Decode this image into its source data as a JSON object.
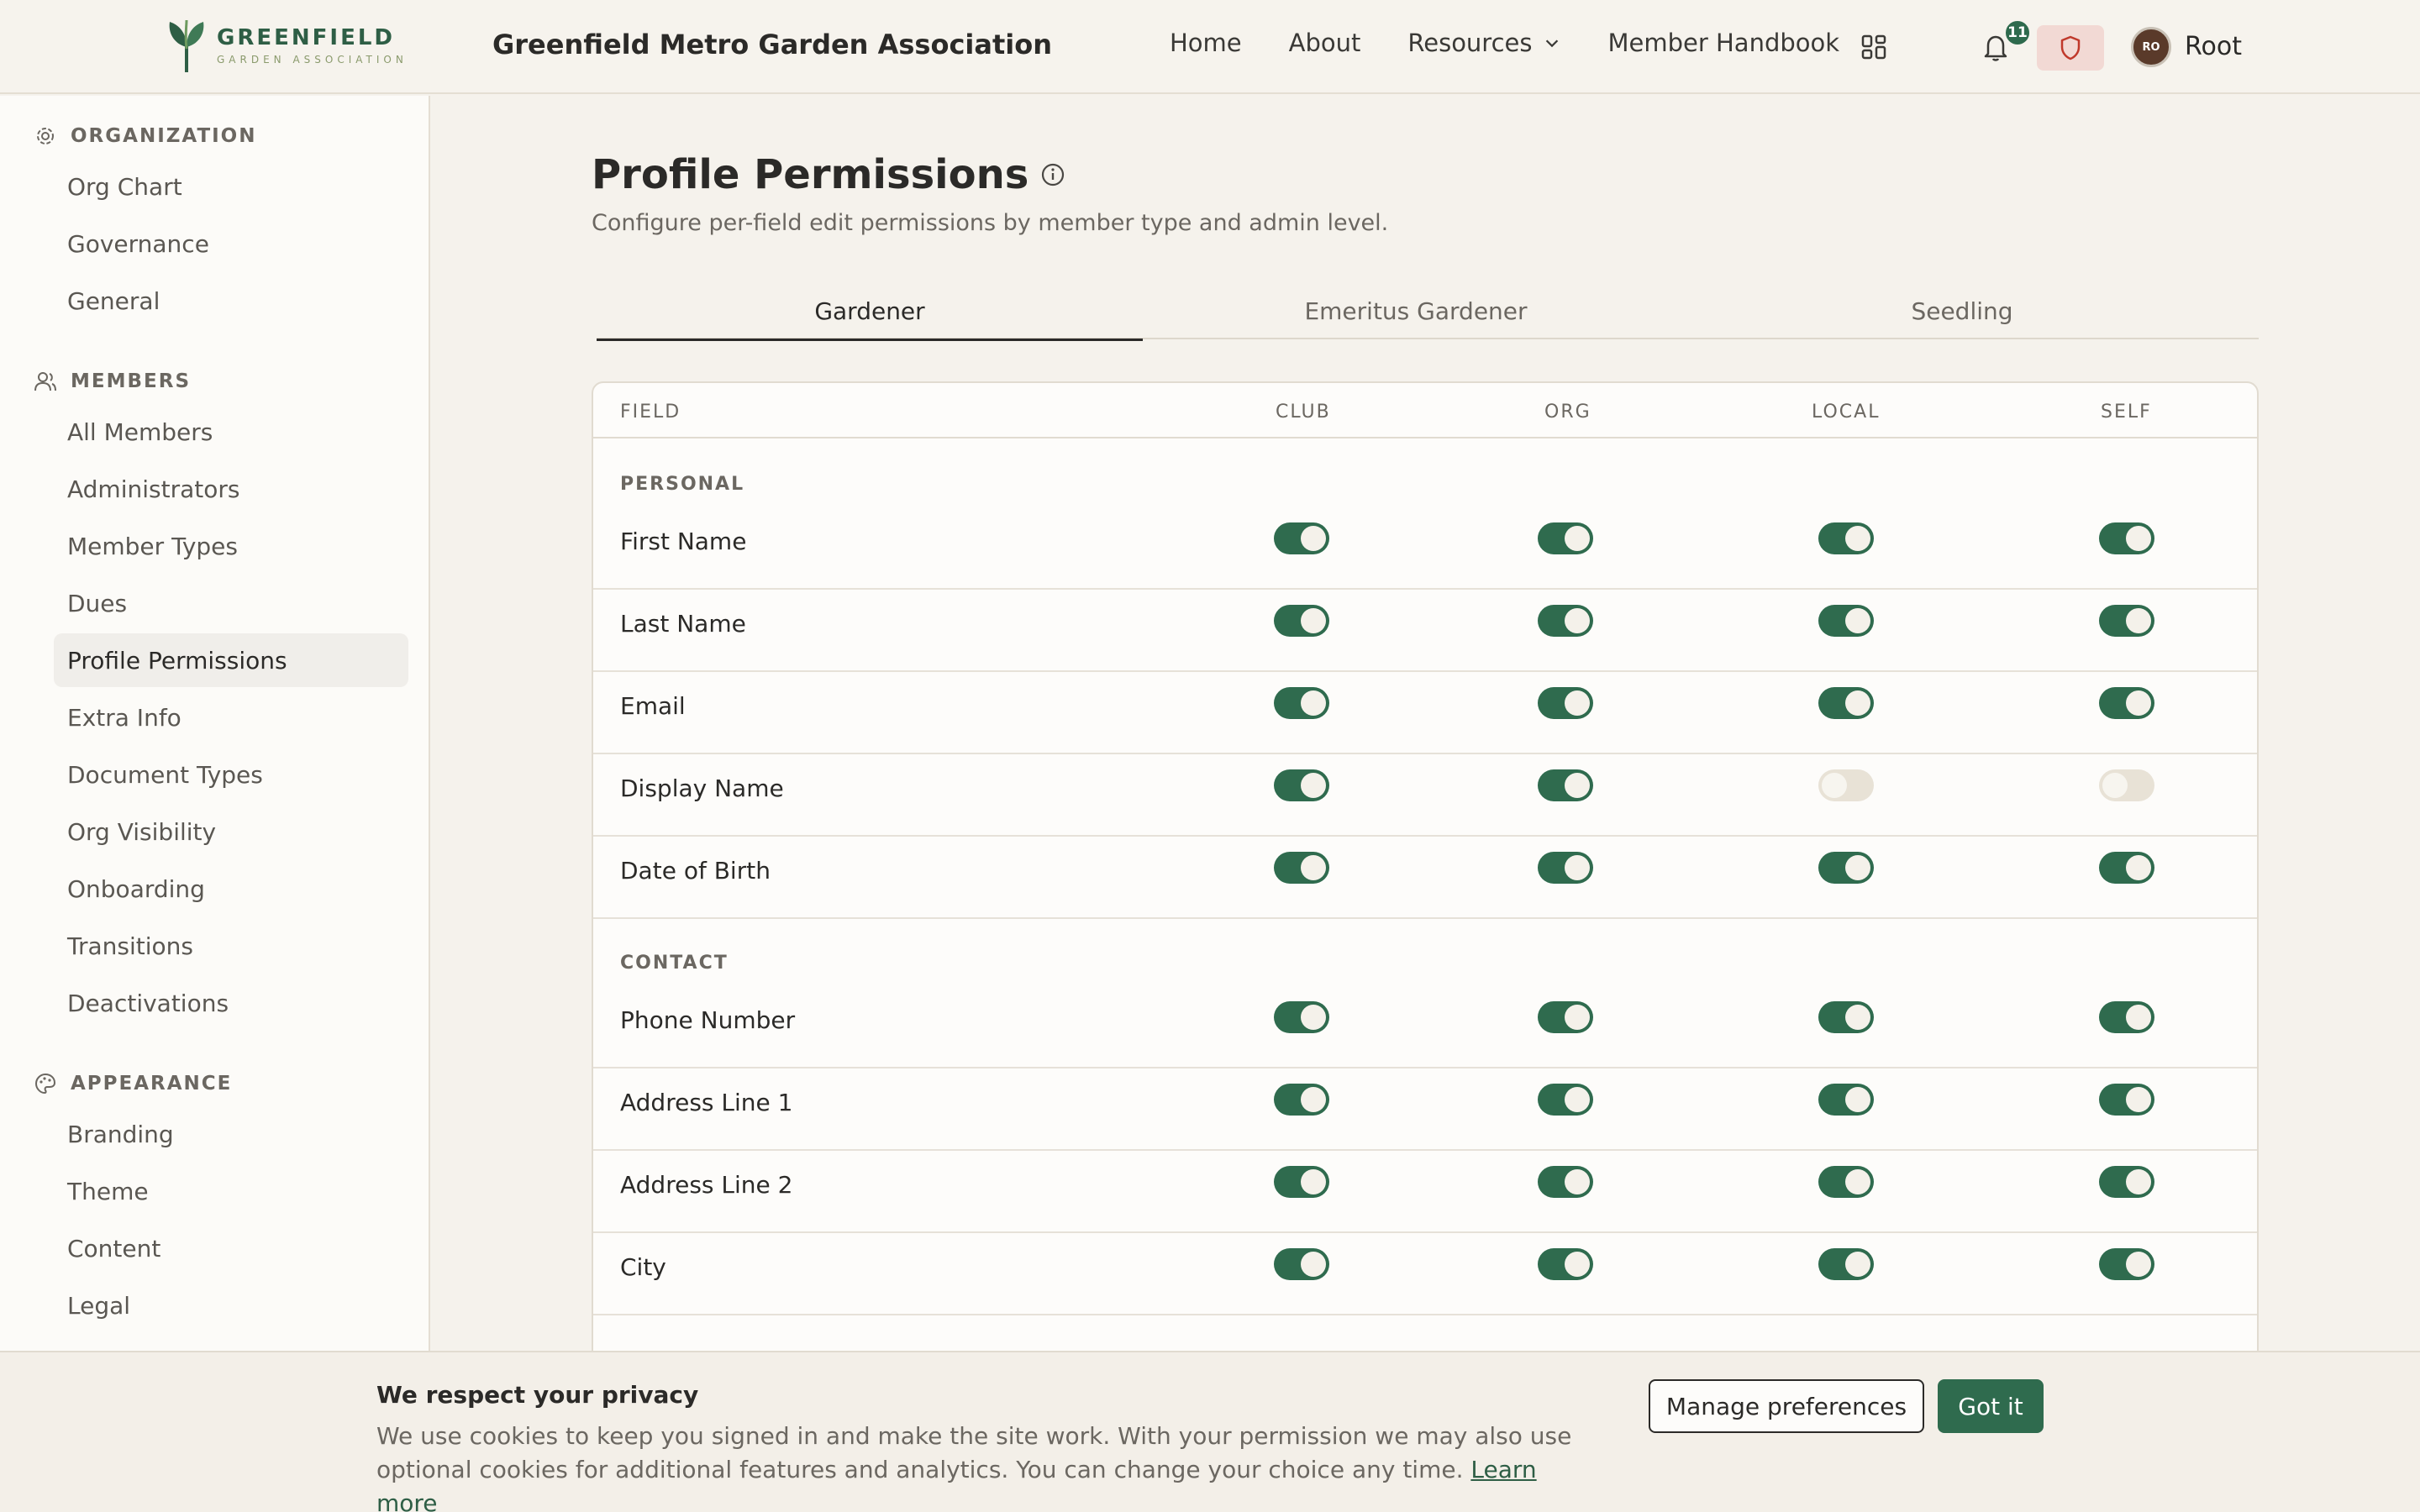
{
  "header": {
    "logo_title": "GREENFIELD",
    "logo_sub": "GARDEN ASSOCIATION",
    "site_title": "Greenfield Metro Garden Association",
    "nav": [
      "Home",
      "About",
      "Resources",
      "Member Handbook"
    ],
    "notification_count": "11",
    "avatar_initials": "RO",
    "user_name": "Root"
  },
  "sidebar": {
    "sections": [
      {
        "title": "ORGANIZATION",
        "icon": "gear-icon",
        "items": [
          "Org Chart",
          "Governance",
          "General"
        ]
      },
      {
        "title": "MEMBERS",
        "icon": "users-icon",
        "items": [
          "All Members",
          "Administrators",
          "Member Types",
          "Dues",
          "Profile Permissions",
          "Extra Info",
          "Document Types",
          "Org Visibility",
          "Onboarding",
          "Transitions",
          "Deactivations"
        ]
      },
      {
        "title": "APPEARANCE",
        "icon": "palette-icon",
        "items": [
          "Branding",
          "Theme",
          "Content",
          "Legal"
        ]
      }
    ],
    "active_item": "Profile Permissions"
  },
  "main": {
    "title": "Profile Permissions",
    "subtitle": "Configure per-field edit permissions by member type and admin level.",
    "tabs": [
      "Gardener",
      "Emeritus Gardener",
      "Seedling"
    ],
    "active_tab": "Gardener",
    "columns": [
      "FIELD",
      "CLUB",
      "ORG",
      "LOCAL",
      "SELF"
    ],
    "groups": [
      {
        "label": "PERSONAL",
        "rows": [
          {
            "field": "First Name",
            "toggles": [
              true,
              true,
              true,
              true
            ]
          },
          {
            "field": "Last Name",
            "toggles": [
              true,
              true,
              true,
              true
            ]
          },
          {
            "field": "Email",
            "toggles": [
              true,
              true,
              true,
              true
            ]
          },
          {
            "field": "Display Name",
            "toggles": [
              true,
              true,
              false,
              false
            ]
          },
          {
            "field": "Date of Birth",
            "toggles": [
              true,
              true,
              true,
              true
            ]
          }
        ]
      },
      {
        "label": "CONTACT",
        "rows": [
          {
            "field": "Phone Number",
            "toggles": [
              true,
              true,
              true,
              true
            ]
          },
          {
            "field": "Address Line 1",
            "toggles": [
              true,
              true,
              true,
              true
            ]
          },
          {
            "field": "Address Line 2",
            "toggles": [
              true,
              true,
              true,
              true
            ]
          },
          {
            "field": "City",
            "toggles": [
              true,
              true,
              true,
              true
            ]
          }
        ]
      }
    ]
  },
  "cookie": {
    "title": "We respect your privacy",
    "text": "We use cookies to keep you signed in and make the site work. With your permission we may also use optional cookies for additional features and analytics. You can change your choice any time.",
    "link": "Learn more",
    "manage_label": "Manage preferences",
    "accept_label": "Got it"
  },
  "colors": {
    "accent": "#2f6b4e",
    "toggle_off": "#e8e2d6",
    "background": "#f5f2ec"
  }
}
